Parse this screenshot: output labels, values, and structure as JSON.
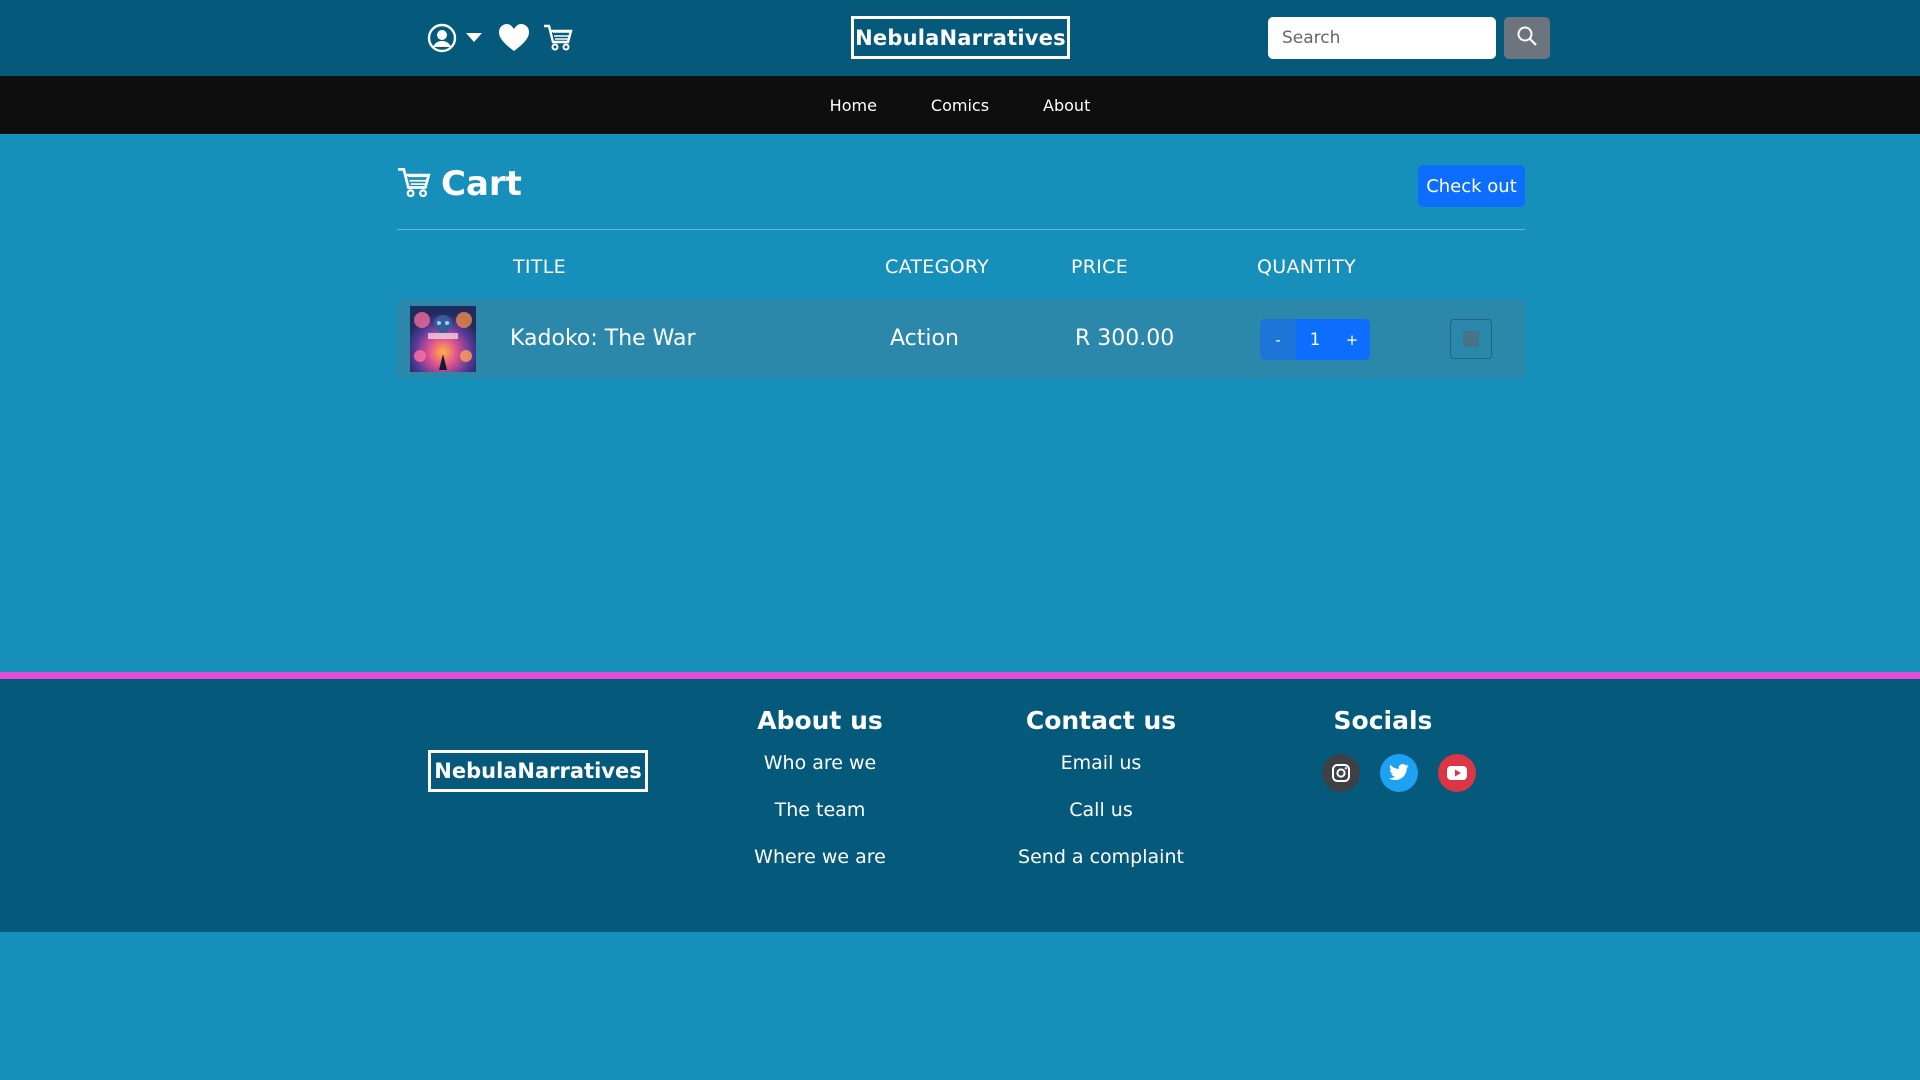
{
  "header": {
    "brand": "NebulaNarratives",
    "search_placeholder": "Search",
    "icons": [
      "user-circle-icon",
      "caret-down-icon",
      "heart-icon",
      "cart-icon",
      "search-icon"
    ]
  },
  "nav": {
    "items": [
      "Home",
      "Comics",
      "About"
    ]
  },
  "cart": {
    "title": "Cart",
    "checkout_label": "Check out",
    "columns": [
      "TITLE",
      "CATEGORY",
      "PRICE",
      "QUANTITY"
    ],
    "items": [
      {
        "title": "Kadoko: The War",
        "category": "Action",
        "price": "R 300.00",
        "quantity": "1",
        "minus": "-",
        "plus": "+"
      }
    ]
  },
  "footer": {
    "brand": "NebulaNarratives",
    "about": {
      "heading": "About us",
      "links": [
        "Who are we",
        "The team",
        "Where we are"
      ]
    },
    "contact": {
      "heading": "Contact us",
      "links": [
        "Email us",
        "Call us",
        "Send a complaint"
      ]
    },
    "socials": {
      "heading": "Socials",
      "icons": [
        "instagram-icon",
        "twitter-icon",
        "youtube-icon"
      ]
    }
  },
  "colors": {
    "header_bg": "#055a7c",
    "page_bg": "#1690bb",
    "nav_bg": "#0e0e0e",
    "primary": "#0d6efd",
    "accent_line": "#dd4fd7",
    "instagram": "#3f3f46",
    "twitter": "#1da1f2",
    "youtube": "#dc3545"
  }
}
